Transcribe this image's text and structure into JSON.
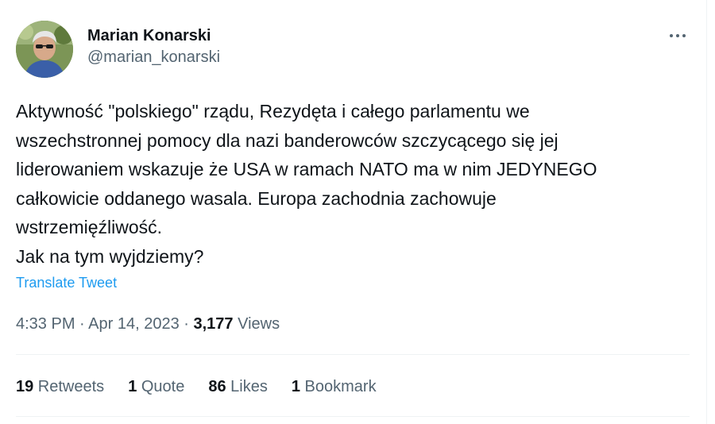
{
  "author": {
    "display_name": "Marian Konarski",
    "handle": "@marian_konarski",
    "avatar_icon": "profile-photo"
  },
  "more_icon": "more-horizontal-icon",
  "tweet": {
    "text": "Aktywność \"polskiego\" rządu, Rezydęta i całego parlamentu we\nwszechstronnej pomocy dla nazi banderowców szczycącego się jej\nliderowaniem wskazuje że USA w ramach NATO ma w nim JEDYNEGO\ncałkowicie oddanego wasala. Europa zachodnia zachowuje\nwstrzemięźliwość.\nJak na tym wyjdziemy?",
    "translate_label": "Translate Tweet"
  },
  "meta": {
    "time": "4:33 PM",
    "separator": " · ",
    "date": "Apr 14, 2023",
    "views_count": "3,177",
    "views_label": " Views"
  },
  "stats": {
    "retweets_count": "19",
    "retweets_label": " Retweets",
    "quotes_count": "1",
    "quotes_label": " Quote",
    "likes_count": "86",
    "likes_label": " Likes",
    "bookmarks_count": "1",
    "bookmarks_label": " Bookmark"
  },
  "colors": {
    "text_primary": "#0f1419",
    "text_secondary": "#536471",
    "link": "#1d9bf0",
    "divider": "#eff3f4"
  }
}
